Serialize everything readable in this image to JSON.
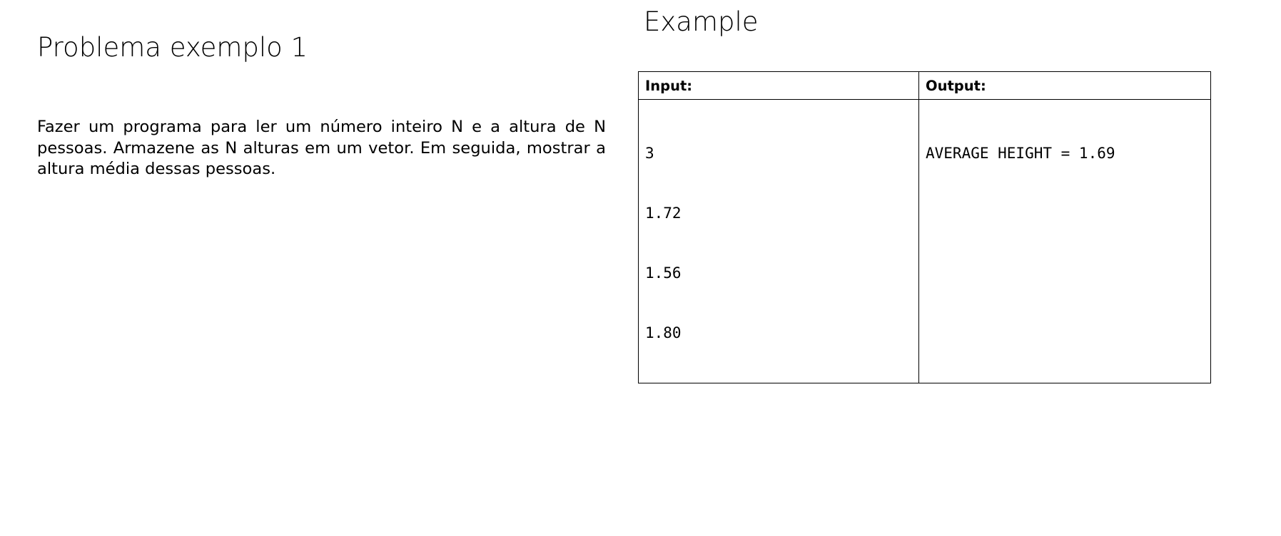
{
  "problem": {
    "title": "Problema exemplo 1",
    "description": "Fazer um programa para ler um número inteiro N e a altura de N pessoas. Armazene as N alturas em um vetor. Em seguida, mostrar a altura média dessas pessoas."
  },
  "example": {
    "title": "Example",
    "input_header": "Input:",
    "output_header": "Output:",
    "input_lines": [
      "3",
      "1.72",
      "1.56",
      "1.80"
    ],
    "output_lines": [
      "AVERAGE HEIGHT = 1.69"
    ]
  }
}
